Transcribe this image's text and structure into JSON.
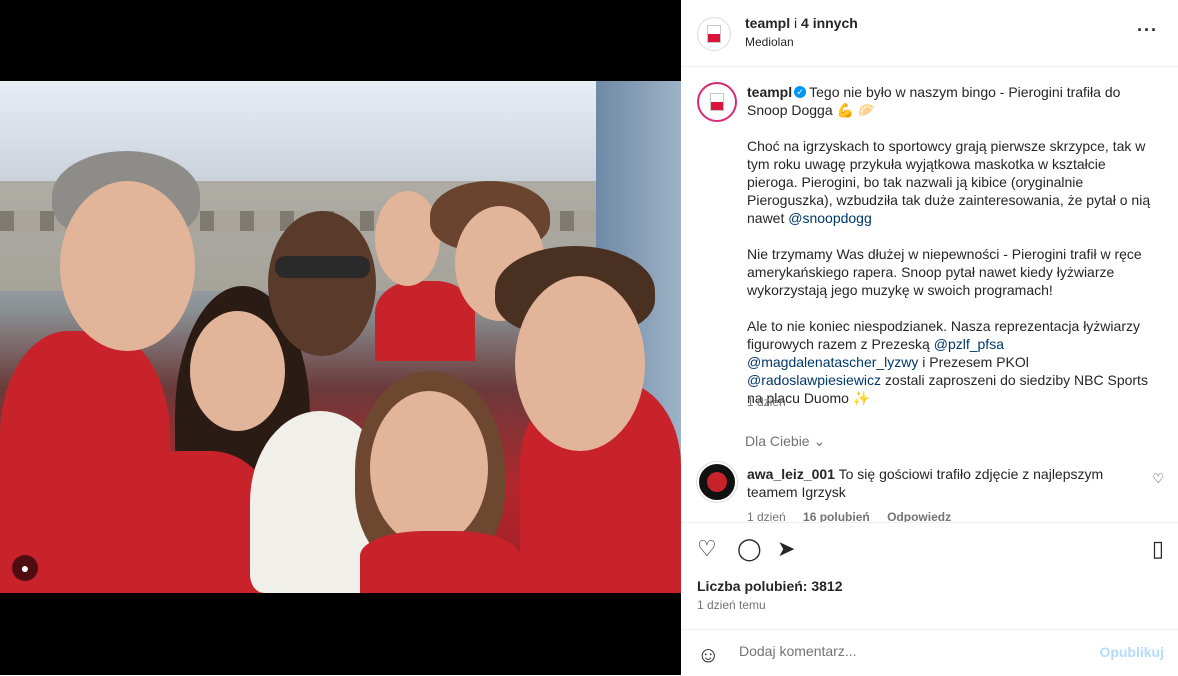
{
  "header": {
    "username": "teampl",
    "separator": " i ",
    "others": "4 innych",
    "location": "Mediolan"
  },
  "icons": {
    "more": "more-horizontal-icon",
    "verified": "verified-badge-icon",
    "heart": "heart-icon",
    "comment": "comment-icon",
    "share": "share-icon",
    "save": "bookmark-icon",
    "emoji": "emoji-icon",
    "user_tag": "user-tag-icon"
  },
  "caption": {
    "username": "teampl",
    "line1": "Tego nie było w naszym bingo - Pierogini trafiła do Snoop Dogga 💪 🥟",
    "p2": "Choć na igrzyskach to sportowcy grają pierwsze skrzypce, tak w tym roku uwagę przykuła wyjątkowa maskotka w kształcie pieroga. Pierogini, bo tak nazwali ją kibice (oryginalnie Pieroguszka), wzbudziła tak duże zainteresowania, że pytał o nią nawet",
    "p2_mention": "@snoopdogg",
    "p3": "Nie trzymamy Was dłużej w niepewności - Pierogini trafił w ręce amerykańskiego rapera. Snoop pytał nawet kiedy łyżwiarze wykorzystają jego muzykę w swoich programach!",
    "p4_a": "Ale to nie koniec niespodzianek. Nasza reprezentacja łyżwiarzy figurowych razem z Prezeską",
    "p4_m1": "@pzlf_pfsa",
    "p4_m2": "@magdalenatascher_lyzwy",
    "p4_b": " i Prezesem PKOl ",
    "p4_m3": "@radoslawpiesiewicz",
    "p4_c": " zostali zaproszeni do siedziby NBC Sports na placu Duomo ✨",
    "time": "1 dzień"
  },
  "for_you": "Dla Ciebie",
  "comment": {
    "username": "awa_leiz_001",
    "text": "To się gościowi trafiło zdjęcie z najlepszym teamem Igrzysk",
    "time": "1 dzień",
    "likes": "16 polubień",
    "reply": "Odpowiedz"
  },
  "likes": "Liczba polubień: 3812",
  "posted": "1 dzień temu",
  "add_comment": {
    "placeholder": "Dodaj komentarz...",
    "post_label": "Opublikuj"
  },
  "colors": {
    "link": "#00376b",
    "verified": "#0095f6",
    "post_disabled": "#b3dbff"
  }
}
